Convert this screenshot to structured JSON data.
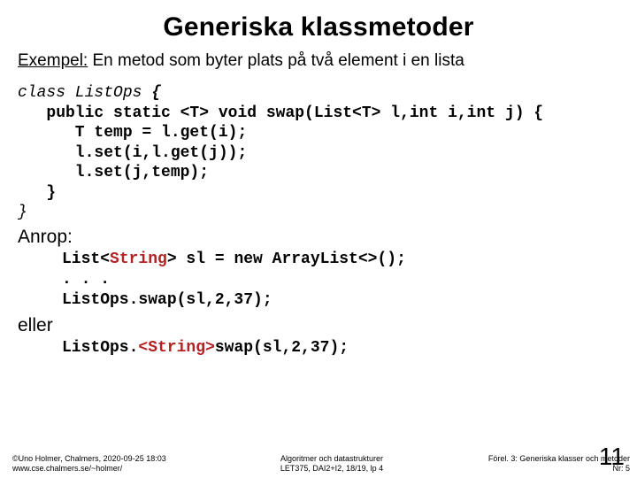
{
  "title": "Generiska klassmetoder",
  "subtitle_prefix": "Exempel:",
  "subtitle_rest": " En metod som byter plats på två element i en lista",
  "code1": {
    "l1a": "class ListOps ",
    "l1b": "{",
    "l2": "   public static <T> void swap(List<T> l,int i,int j) {",
    "l3": "      T temp = l.get(i);",
    "l4": "      l.set(i,l.get(j));",
    "l5": "      l.set(j,temp);",
    "l6": "   }",
    "l7": "}"
  },
  "label_call": "Anrop:",
  "code2": {
    "l1a": "List<",
    "l1b": "String",
    "l1c": "> sl = new ArrayList<>();",
    "l2": ". . .",
    "l3": "ListOps.swap(sl,2,37);"
  },
  "label_or": "eller",
  "code3": {
    "l1a": "ListOps.",
    "l1b": "<String>",
    "l1c": "swap(sl,2,37);"
  },
  "footer": {
    "left1": "©Uno Holmer, Chalmers, 2020-09-25 18:03",
    "left2": "www.cse.chalmers.se/~holmer/",
    "mid1": "Algoritmer och datastrukturer",
    "mid2": "LET375, DAI2+I2, 18/19, lp 4",
    "right1": "Förel. 3: Generiska klasser och metoder",
    "right2": "Nr: 5"
  },
  "page_number": "11"
}
